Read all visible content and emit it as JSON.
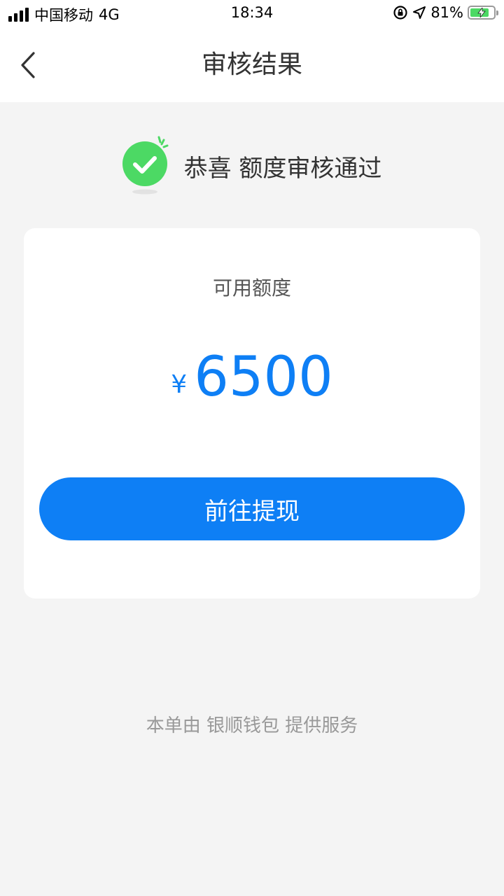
{
  "status_bar": {
    "carrier": "中国移动",
    "network": "4G",
    "time": "18:34",
    "battery_percent": "81%",
    "battery_level": 0.81
  },
  "nav": {
    "title": "审核结果"
  },
  "result": {
    "message": "恭喜 额度审核通过",
    "icon": "check-circle-icon",
    "icon_color": "#4cd964"
  },
  "card": {
    "label": "可用额度",
    "currency": "¥",
    "amount": "6500",
    "button_label": "前往提现"
  },
  "footer": {
    "text": "本单由 银顺钱包 提供服务"
  },
  "colors": {
    "accent": "#0e7ff5",
    "success": "#4cd964",
    "background": "#f4f4f4"
  }
}
